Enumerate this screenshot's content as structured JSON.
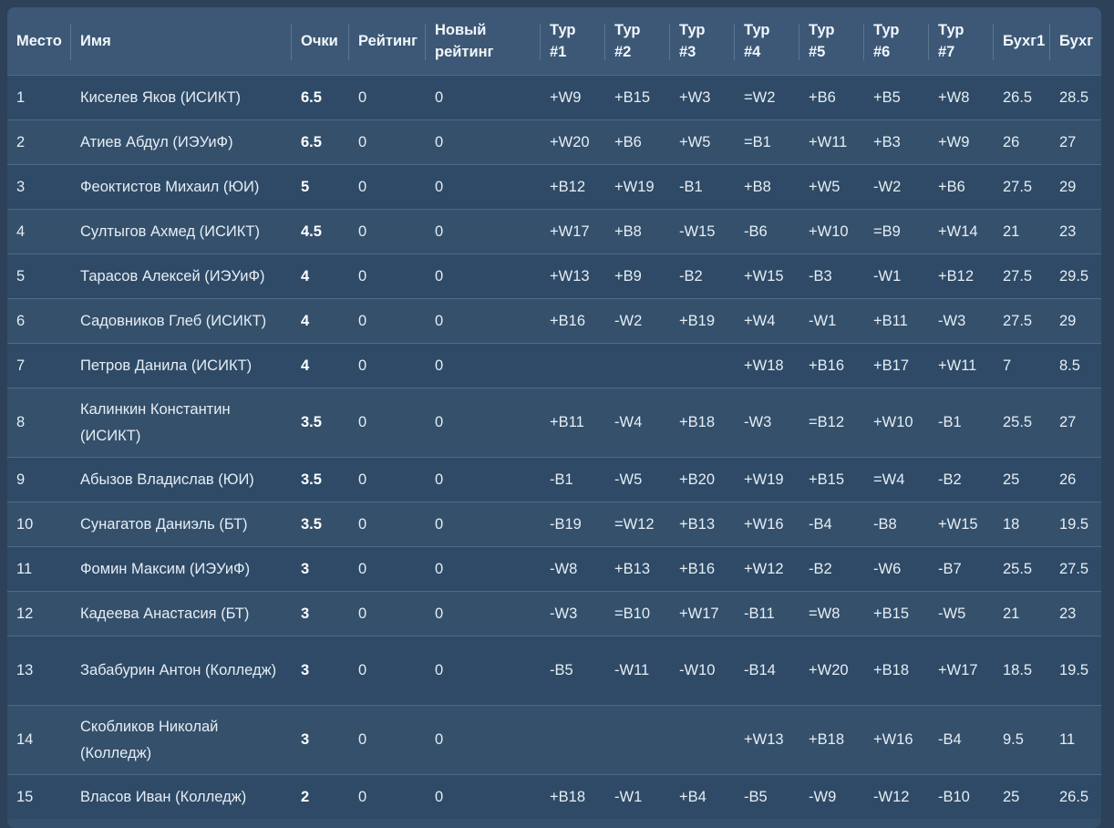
{
  "table": {
    "headers": {
      "place": "Место",
      "name": "Имя",
      "points": "Очки",
      "rating": "Рейтинг",
      "new_rating_1": "Новый",
      "new_rating_2": "рейтинг",
      "round_word": "Тур",
      "round1": "#1",
      "round2": "#2",
      "round3": "#3",
      "round4": "#4",
      "round5": "#5",
      "round6": "#6",
      "round7": "#7",
      "buch1": "Бухг1",
      "buch": "Бухг"
    },
    "rows": [
      {
        "place": "1",
        "name": "Киселев Яков (ИСИКТ)",
        "points": "6.5",
        "rating": "0",
        "new_rating": "0",
        "r1": "+W9",
        "r2": "+B15",
        "r3": "+W3",
        "r4": "=W2",
        "r5": "+B6",
        "r6": "+B5",
        "r7": "+W8",
        "buch1": "26.5",
        "buch": "28.5"
      },
      {
        "place": "2",
        "name": "Атиев Абдул (ИЭУиФ)",
        "points": "6.5",
        "rating": "0",
        "new_rating": "0",
        "r1": "+W20",
        "r2": "+B6",
        "r3": "+W5",
        "r4": "=B1",
        "r5": "+W11",
        "r6": "+B3",
        "r7": "+W9",
        "buch1": "26",
        "buch": "27"
      },
      {
        "place": "3",
        "name": "Феоктистов Михаил (ЮИ)",
        "points": "5",
        "rating": "0",
        "new_rating": "0",
        "r1": "+B12",
        "r2": "+W19",
        "r3": "-B1",
        "r4": "+B8",
        "r5": "+W5",
        "r6": "-W2",
        "r7": "+B6",
        "buch1": "27.5",
        "buch": "29"
      },
      {
        "place": "4",
        "name": "Султыгов Ахмед (ИСИКТ)",
        "points": "4.5",
        "rating": "0",
        "new_rating": "0",
        "r1": "+W17",
        "r2": "+B8",
        "r3": "-W15",
        "r4": "-B6",
        "r5": "+W10",
        "r6": "=B9",
        "r7": "+W14",
        "buch1": "21",
        "buch": "23"
      },
      {
        "place": "5",
        "name": "Тарасов Алексей (ИЭУиФ)",
        "points": "4",
        "rating": "0",
        "new_rating": "0",
        "r1": "+W13",
        "r2": "+B9",
        "r3": "-B2",
        "r4": "+W15",
        "r5": "-B3",
        "r6": "-W1",
        "r7": "+B12",
        "buch1": "27.5",
        "buch": "29.5"
      },
      {
        "place": "6",
        "name": "Садовников Глеб (ИСИКТ)",
        "points": "4",
        "rating": "0",
        "new_rating": "0",
        "r1": "+B16",
        "r2": "-W2",
        "r3": "+B19",
        "r4": "+W4",
        "r5": "-W1",
        "r6": "+B11",
        "r7": "-W3",
        "buch1": "27.5",
        "buch": "29"
      },
      {
        "place": "7",
        "name": "Петров Данила (ИСИКТ)",
        "points": "4",
        "rating": "0",
        "new_rating": "0",
        "r1": "",
        "r2": "",
        "r3": "",
        "r4": "+W18",
        "r5": "+B16",
        "r6": "+B17",
        "r7": "+W11",
        "buch1": "7",
        "buch": "8.5"
      },
      {
        "place": "8",
        "name": "Калинкин Константин (ИСИКТ)",
        "points": "3.5",
        "rating": "0",
        "new_rating": "0",
        "r1": "+B11",
        "r2": "-W4",
        "r3": "+B18",
        "r4": "-W3",
        "r5": "=B12",
        "r6": "+W10",
        "r7": "-B1",
        "buch1": "25.5",
        "buch": "27"
      },
      {
        "place": "9",
        "name": "Абызов Владислав (ЮИ)",
        "points": "3.5",
        "rating": "0",
        "new_rating": "0",
        "r1": "-B1",
        "r2": "-W5",
        "r3": "+B20",
        "r4": "+W19",
        "r5": "+B15",
        "r6": "=W4",
        "r7": "-B2",
        "buch1": "25",
        "buch": "26"
      },
      {
        "place": "10",
        "name": "Сунагатов Даниэль (БТ)",
        "points": "3.5",
        "rating": "0",
        "new_rating": "0",
        "r1": "-B19",
        "r2": "=W12",
        "r3": "+B13",
        "r4": "+W16",
        "r5": "-B4",
        "r6": "-B8",
        "r7": "+W15",
        "buch1": "18",
        "buch": "19.5"
      },
      {
        "place": "11",
        "name": "Фомин Максим (ИЭУиФ)",
        "points": "3",
        "rating": "0",
        "new_rating": "0",
        "r1": "-W8",
        "r2": "+B13",
        "r3": "+B16",
        "r4": "+W12",
        "r5": "-B2",
        "r6": "-W6",
        "r7": "-B7",
        "buch1": "25.5",
        "buch": "27.5"
      },
      {
        "place": "12",
        "name": "Кадеева Анастасия (БТ)",
        "points": "3",
        "rating": "0",
        "new_rating": "0",
        "r1": "-W3",
        "r2": "=B10",
        "r3": "+W17",
        "r4": "-B11",
        "r5": "=W8",
        "r6": "+B15",
        "r7": "-W5",
        "buch1": "21",
        "buch": "23"
      },
      {
        "place": "13",
        "name": "Забабурин Антон (Колледж)",
        "points": "3",
        "rating": "0",
        "new_rating": "0",
        "r1": "-B5",
        "r2": "-W11",
        "r3": "-W10",
        "r4": "-B14",
        "r5": "+W20",
        "r6": "+B18",
        "r7": "+W17",
        "buch1": "18.5",
        "buch": "19.5"
      },
      {
        "place": "14",
        "name": "Скобликов Николай (Колледж)",
        "points": "3",
        "rating": "0",
        "new_rating": "0",
        "r1": "",
        "r2": "",
        "r3": "",
        "r4": "+W13",
        "r5": "+B18",
        "r6": "+W16",
        "r7": "-B4",
        "buch1": "9.5",
        "buch": "11"
      },
      {
        "place": "15",
        "name": "Власов Иван (Колледж)",
        "points": "2",
        "rating": "0",
        "new_rating": "0",
        "r1": "+B18",
        "r2": "-W1",
        "r3": "+B4",
        "r4": "-B5",
        "r5": "-W9",
        "r6": "-W12",
        "r7": "-B10",
        "buch1": "25",
        "buch": "26.5"
      }
    ]
  }
}
